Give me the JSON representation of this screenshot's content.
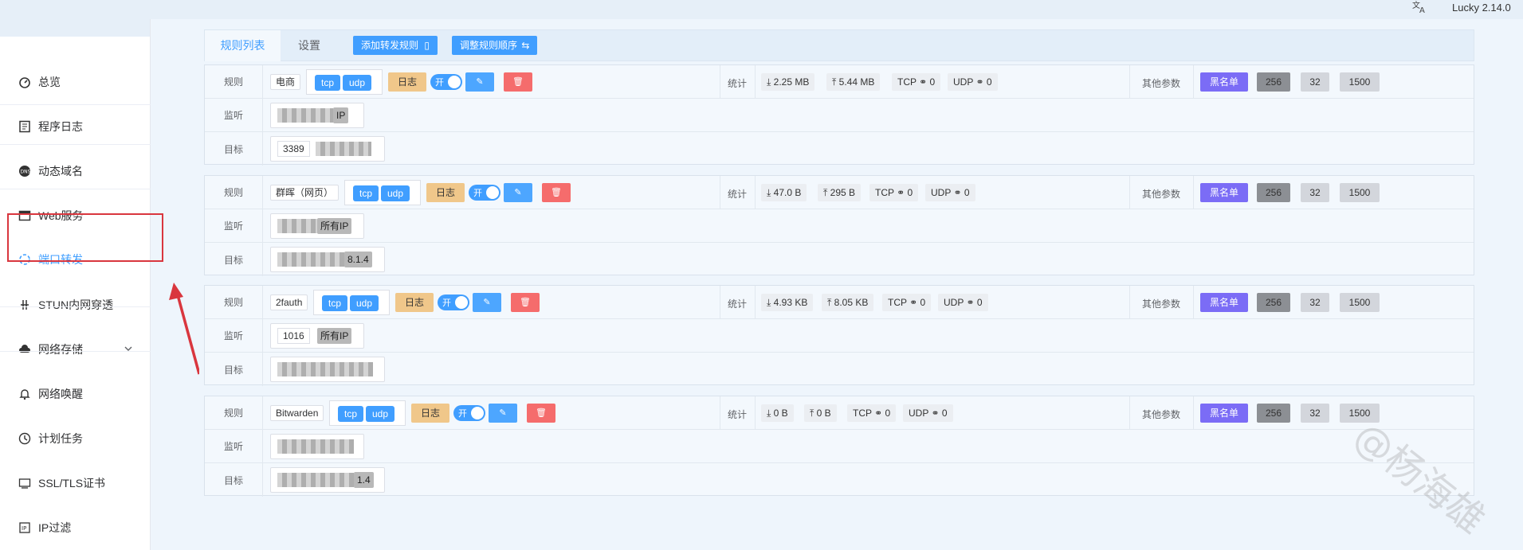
{
  "app": {
    "version": "Lucky 2.14.0",
    "translate_icon": "translate-icon"
  },
  "sidebar": {
    "items": [
      {
        "label": "总览",
        "icon": "dashboard-icon"
      },
      {
        "label": "程序日志",
        "icon": "log-icon"
      },
      {
        "label": "动态域名",
        "icon": "dns-icon"
      },
      {
        "label": "Web服务",
        "icon": "web-icon"
      },
      {
        "label": "端口转发",
        "icon": "port-forward-icon",
        "active": true
      },
      {
        "label": "STUN内网穿透",
        "icon": "stun-icon"
      },
      {
        "label": "网络存储",
        "icon": "cloud-icon",
        "expandable": true
      },
      {
        "label": "网络唤醒",
        "icon": "bell-icon"
      },
      {
        "label": "计划任务",
        "icon": "clock-icon"
      },
      {
        "label": "SSL/TLS证书",
        "icon": "certificate-icon"
      },
      {
        "label": "IP过滤",
        "icon": "filter-icon"
      }
    ]
  },
  "tabs": {
    "rules_list": "规则列表",
    "settings": "设置",
    "add_rule": "添加转发规则",
    "reorder": "调整规则顺序"
  },
  "labels": {
    "rule": "规则",
    "listen": "监听",
    "target": "目标",
    "stats": "统计",
    "other_params": "其他参数",
    "log": "日志",
    "on": "开",
    "blacklist": "黑名单",
    "tcp": "tcp",
    "udp": "udp"
  },
  "rules": [
    {
      "name": "电商",
      "download": "2.25 MB",
      "upload": "5.44 MB",
      "tcp": "TCP",
      "tcp_conn": "0",
      "udp": "UDP",
      "udp_conn": "0",
      "params": [
        "256",
        "32",
        "1500"
      ],
      "listen_tag": "IP",
      "target_port": "3389",
      "target_tag": ""
    },
    {
      "name": "群晖（网页）",
      "download": "47.0 B",
      "upload": "295 B",
      "tcp": "TCP",
      "tcp_conn": "0",
      "udp": "UDP",
      "udp_conn": "0",
      "params": [
        "256",
        "32",
        "1500"
      ],
      "listen_tag": "所有IP",
      "target_port": "",
      "target_tag": "8.1.4"
    },
    {
      "name": "2fauth",
      "download": "4.93 KB",
      "upload": "8.05 KB",
      "tcp": "TCP",
      "tcp_conn": "0",
      "udp": "UDP",
      "udp_conn": "0",
      "params": [
        "256",
        "32",
        "1500"
      ],
      "listen_port": "1016",
      "listen_tag": "所有IP",
      "target_port": "",
      "target_tag": ""
    },
    {
      "name": "Bitwarden",
      "download": "0 B",
      "upload": "0 B",
      "tcp": "TCP",
      "tcp_conn": "0",
      "udp": "UDP",
      "udp_conn": "0",
      "params": [
        "256",
        "32",
        "1500"
      ],
      "listen_tag": "",
      "target_port": "",
      "target_tag": "1.4"
    }
  ],
  "watermark": "@杨海雄"
}
